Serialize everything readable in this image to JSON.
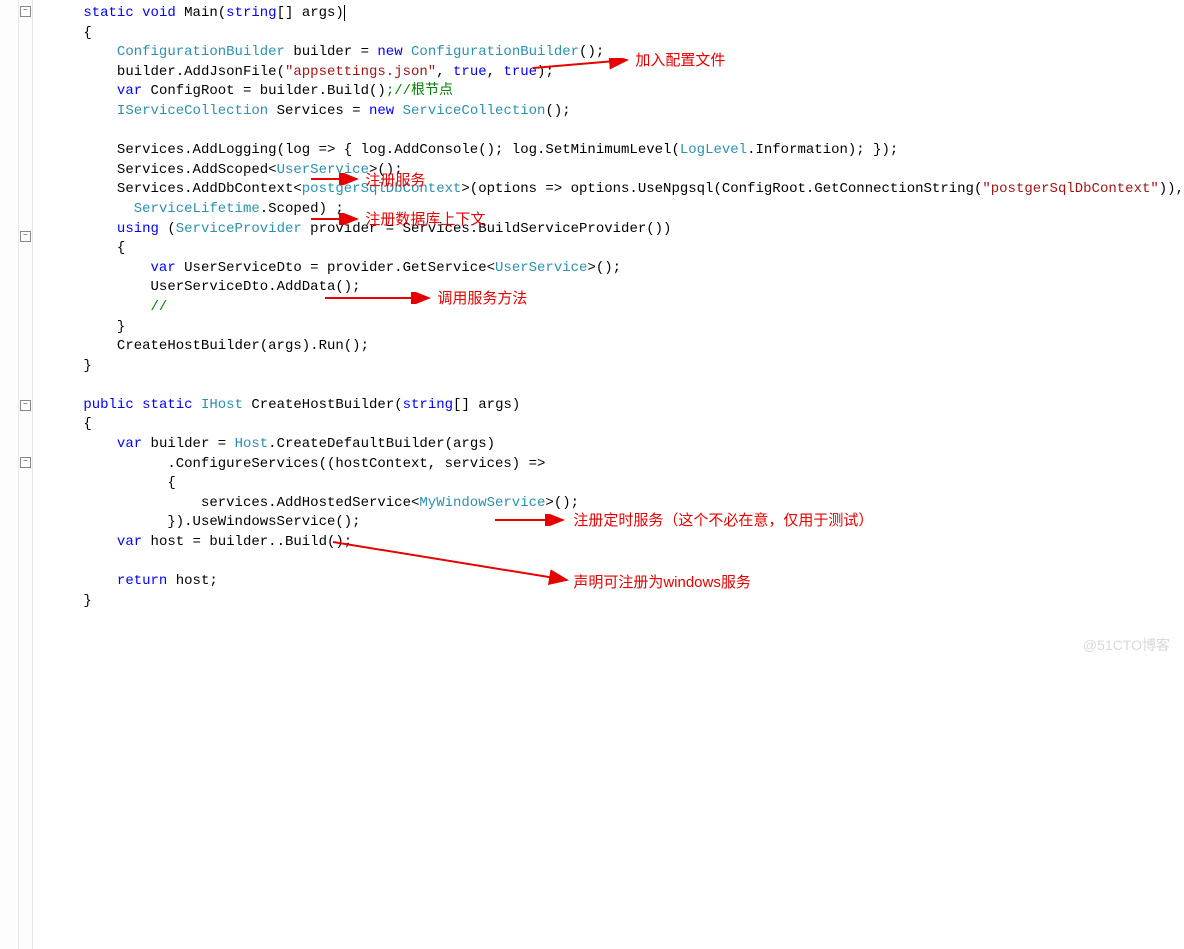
{
  "tokens": {
    "kw_static": "static",
    "kw_void": "void",
    "kw_public": "public",
    "kw_new": "new",
    "kw_var": "var",
    "kw_true": "true",
    "kw_using": "using",
    "kw_return": "return",
    "kw_string_arr": "string",
    "main": "Main",
    "args": "args",
    "string_args": "string[] args",
    "ConfigurationBuilder": "ConfigurationBuilder",
    "builder_var": "builder",
    "eq": " = ",
    "paren_semi": "();",
    "builder_dot": "builder.",
    "AddJsonFile": "AddJsonFile",
    "appsettings": "\"appsettings.json\"",
    "comma_sp": ", ",
    "close_paren_semi": ");",
    "ConfigRoot": "ConfigRoot",
    "Build": ".Build()",
    "cmt_root": ";//根节点",
    "IServiceCollection": "IServiceCollection",
    "Services": "Services",
    "ServiceCollection": "ServiceCollection",
    "Services_dot": "Services.",
    "AddLogging": "AddLogging",
    "log_lambda": "(log => { log.",
    "AddConsole": "AddConsole",
    "AddConsole_tail": "(); log.",
    "SetMinimumLevel": "SetMinimumLevel",
    "smm_open": "(",
    "LogLevel": "LogLevel",
    "Information": ".Information",
    "addlog_tail": "); });",
    "AddScoped_open": "AddScoped<",
    "UserService": "UserService",
    "close_generic_call": ">();",
    "AddDbContext_open": "AddDbContext<",
    "postgerSqlDbContext": "postgerSqlDbContext",
    "dbctx_mid1": ">(options => options.",
    "UseNpgsql": "UseNpgsql",
    "usenpg_open": "(ConfigRoot.",
    "GetConnectionString": "GetConnectionString",
    "conn_open": "(",
    "conn_str": "\"postgerSqlDbContext\"",
    "conn_close": ")),",
    "indent_sl": "      ",
    "ServiceLifetime": "ServiceLifetime",
    "Scoped_tail": ".Scoped) ;",
    "using_open": " (",
    "ServiceProvider": "ServiceProvider",
    "provider_decl": " provider = Services.",
    "BuildServiceProvider": "BuildServiceProvider",
    "close_paren_paren": "())",
    "UserServiceDto_decl": " UserServiceDto = provider.",
    "GetService_open": "GetService<",
    "UserServiceDto_call": "UserServiceDto.",
    "AddData": "AddData",
    "cmt_slashes": "//",
    "CreateHostBuilder_call": "CreateHostBuilder(args).",
    "Run": "Run",
    "IHost": "IHost",
    "CreateHostBuilder": "CreateHostBuilder",
    "sig_open": "(",
    "sig_close": ")",
    "builder_eq": " builder = ",
    "Host": "Host",
    "CreateDefaultBuilder": ".CreateDefaultBuilder",
    "cdb_args": "(args)",
    "dot_ConfigureServices": ".ConfigureServices",
    "cs_params": "((hostContext, services) =>",
    "services_dot": "services.",
    "AddHostedService_open": "AddHostedService<",
    "MyWindowService": "MyWindowService",
    "line_close_use": "}).",
    "UseWindowsService": "UseWindowsService",
    "host_decl": " host = builder.",
    "return_host": " host;",
    "brace_open": "{",
    "brace_close": "}"
  },
  "annotations": {
    "a1": "加入配置文件",
    "a2": "注册服务",
    "a3": "注册数据库上下文",
    "a4": "调用服务方法",
    "a5": "注册定时服务（这个不必在意，仅用于测试）",
    "a6": "声明可注册为windows服务"
  },
  "watermark": "@51CTO博客",
  "fold_minus": "−"
}
